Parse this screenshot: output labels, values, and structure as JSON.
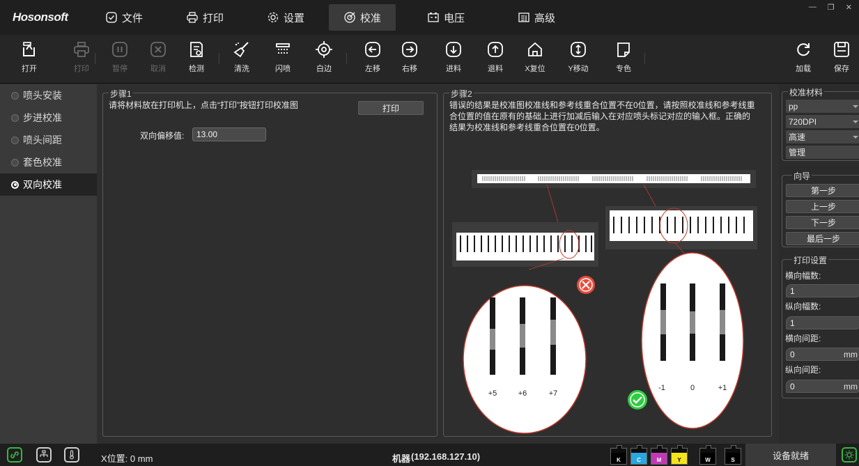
{
  "app": {
    "logo": "Hosonsoft"
  },
  "menu": [
    {
      "label": "文件",
      "icon": "checkbox-file-icon"
    },
    {
      "label": "打印",
      "icon": "printer-icon"
    },
    {
      "label": "设置",
      "icon": "gear-icon"
    },
    {
      "label": "校准",
      "icon": "target-icon",
      "active": true
    },
    {
      "label": "电压",
      "icon": "battery-icon"
    },
    {
      "label": "高级",
      "icon": "advanced-icon"
    }
  ],
  "toolbar": {
    "open": "打开",
    "print": "打印",
    "pause": "暂停",
    "cancel": "取消",
    "detect": "检测",
    "clean": "清洗",
    "flash": "闪喷",
    "white_edge": "白边",
    "move_left": "左移",
    "move_right": "右移",
    "feed": "进料",
    "retract": "退料",
    "x_reset": "X复位",
    "y_move": "Y移动",
    "spot_color": "专色",
    "reload": "加载",
    "save": "保存"
  },
  "sidebar": {
    "items": [
      {
        "label": "喷头安装",
        "active": false
      },
      {
        "label": "步进校准",
        "active": false
      },
      {
        "label": "喷头间距",
        "active": false
      },
      {
        "label": "套色校准",
        "active": false
      },
      {
        "label": "双向校准",
        "active": true
      }
    ]
  },
  "step1": {
    "title": "步骤1",
    "instruction": "请将材料放在打印机上，点击“打印”按钮打印校准图",
    "print_button": "打印",
    "offset_label": "双向偏移值:",
    "offset_value": "13.00"
  },
  "step2": {
    "title": "步骤2",
    "instruction_lines": [
      "错误的结果是校准图校准线和参考线重合位置不在0位置，请按照校准线和参考线重",
      "合位置的值在原有的基础上进行加减后输入在对应喷头标记对应的输入框。正确的",
      "结果为校准线和参考线重合位置在0位置。"
    ],
    "diagram": {
      "wrong_labels": [
        "+5",
        "+6",
        "+7"
      ],
      "right_labels": [
        "-1",
        "0",
        "+1"
      ]
    }
  },
  "right_panel": {
    "material_title": "校准材料",
    "material": "pp",
    "resolution": "720DPI",
    "speed": "高速",
    "manage": "管理",
    "wizard_title": "向导",
    "first_step": "第一步",
    "prev_step": "上一步",
    "next_step": "下一步",
    "last_step": "最后一步",
    "print_settings_title": "打印设置",
    "h_copies_label": "横向幅数:",
    "h_copies": "1",
    "v_copies_label": "纵向幅数:",
    "v_copies": "1",
    "h_spacing_label": "横向间距:",
    "h_spacing": "0",
    "v_spacing_label": "纵向间距:",
    "v_spacing": "0",
    "unit": "mm"
  },
  "status": {
    "x_position": "X位置: 0 mm",
    "machine_label": "机器",
    "machine_ip": "(192.168.127.10)",
    "inks": [
      {
        "label": "K",
        "color": "#000000"
      },
      {
        "label": "C",
        "color": "#2aa6e0"
      },
      {
        "label": "M",
        "color": "#c03ab6"
      },
      {
        "label": "Y",
        "color": "#f5e31c"
      },
      {
        "label": "W",
        "color": "#000000"
      },
      {
        "label": "S",
        "color": "#000000"
      }
    ],
    "device_status": "设备就绪",
    "accent_green": "#38b544"
  }
}
